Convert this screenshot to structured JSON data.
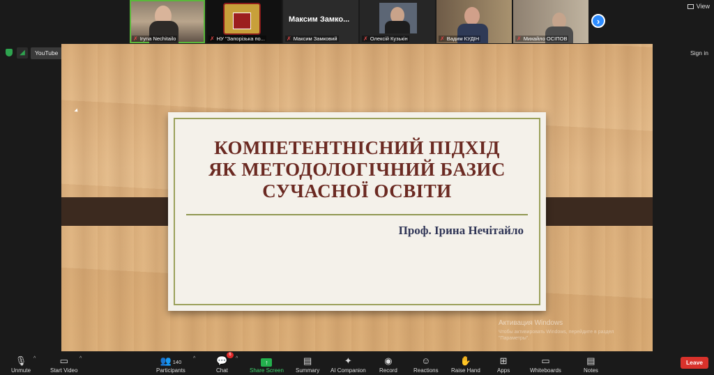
{
  "participants": [
    {
      "name": "Iryna Nechitailo",
      "big_name": "",
      "muted": true
    },
    {
      "name": "НУ \"Запорізька по...",
      "big_name": "",
      "muted": true
    },
    {
      "name": "Максим Замковий",
      "big_name": "Максим  Замко...",
      "muted": true
    },
    {
      "name": "Олексій Кузькін",
      "big_name": "",
      "muted": true
    },
    {
      "name": "Вадим КУДІН",
      "big_name": "",
      "muted": true
    },
    {
      "name": "Михайло ОСІПОВ",
      "big_name": "",
      "muted": true
    }
  ],
  "top": {
    "view_label": "View",
    "youtube_label": "YouTube",
    "signin_label": "Sign in"
  },
  "slide": {
    "title_line1": "КОМПЕТЕНТНІСНИЙ ПІДХІД",
    "title_line2": "ЯК МЕТОДОЛОГІЧНИЙ БАЗИС",
    "title_line3": "СУЧАСНОЇ ОСВІТИ",
    "author": "Проф. Ірина Нечітайло",
    "watermark_title": "Активация Windows",
    "watermark_sub": "Чтобы активировать Windows, перейдите в раздел \"Параметры\"."
  },
  "toolbar": {
    "unmute": "Unmute",
    "start_video": "Start Video",
    "participants": "Participants",
    "participants_count": "140",
    "chat": "Chat",
    "chat_badge": "6",
    "share_screen": "Share Screen",
    "summary": "Summary",
    "ai_companion": "AI Companion",
    "record": "Record",
    "reactions": "Reactions",
    "raise_hand": "Raise Hand",
    "apps": "Apps",
    "whiteboards": "Whiteboards",
    "notes": "Notes",
    "leave": "Leave"
  },
  "colors": {
    "accent": "#2d8cff",
    "leave": "#d9322b",
    "share": "#23b14d",
    "title": "#6b2a22",
    "author": "#2f3556"
  }
}
